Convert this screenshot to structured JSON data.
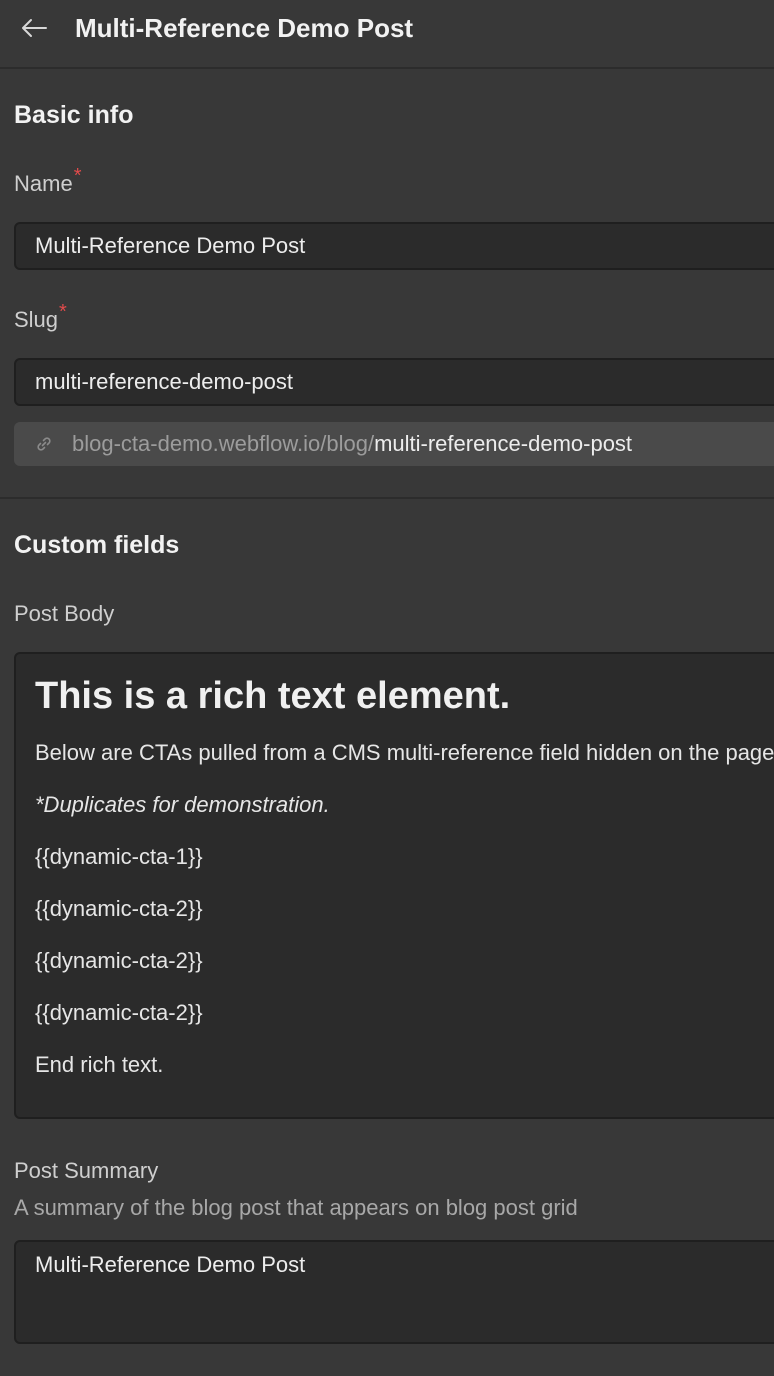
{
  "header": {
    "title": "Multi-Reference Demo Post",
    "back_icon": "arrow-left-icon"
  },
  "basic_info": {
    "title": "Basic info",
    "name_label": "Name",
    "name_value": "Multi-Reference Demo Post",
    "slug_label": "Slug",
    "slug_value": "multi-reference-demo-post",
    "url_base": "blog-cta-demo.webflow.io/blog/",
    "url_slug": "multi-reference-demo-post",
    "required_mark": "*"
  },
  "custom_fields": {
    "title": "Custom fields",
    "post_body_label": "Post Body",
    "post_body": {
      "heading": "This is a rich text element.",
      "paragraphs": [
        "Below are CTAs pulled from a CMS multi-reference field hidden on the page.",
        "*Duplicates for demonstration.",
        "{{dynamic-cta-1}}",
        "{{dynamic-cta-2}}",
        "{{dynamic-cta-2}}",
        "{{dynamic-cta-2}}",
        "End rich text."
      ]
    },
    "post_summary_label": "Post Summary",
    "post_summary_help": "A summary of the blog post that appears on blog post grid",
    "post_summary_value": "Multi-Reference Demo Post"
  },
  "colors": {
    "background": "#383838",
    "field_background": "#2b2b2b",
    "required": "#e24b4b"
  }
}
